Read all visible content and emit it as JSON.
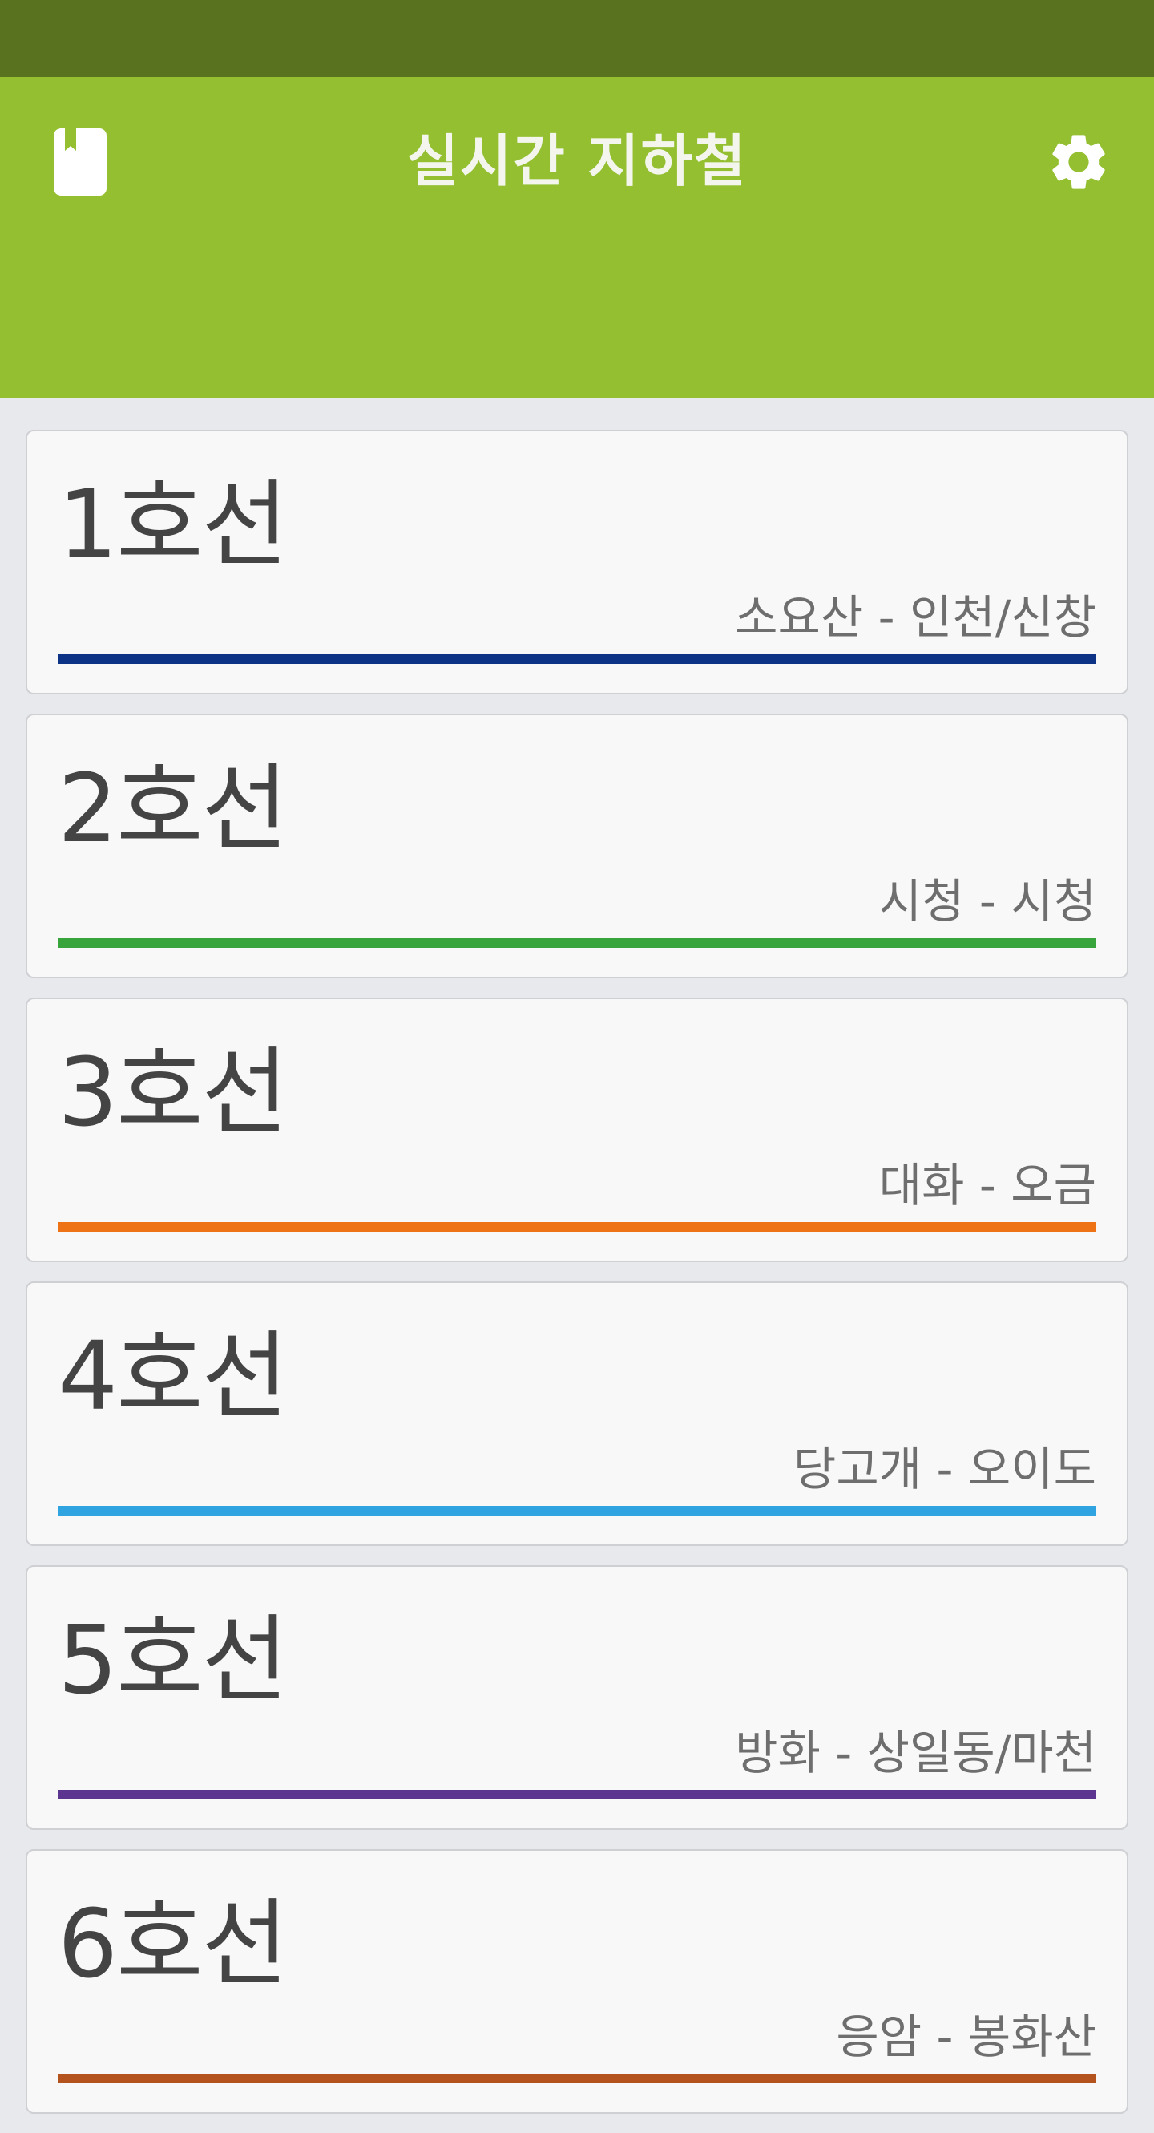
{
  "header": {
    "title": "실시간 지하철",
    "left_icon": "book-icon",
    "right_icon": "gear-icon",
    "color": "#93bf31",
    "status_bar_color": "#58721f"
  },
  "lines": [
    {
      "name": "1호선",
      "route": "소요산 - 인천/신창",
      "color": "#0d3386"
    },
    {
      "name": "2호선",
      "route": "시청 - 시청",
      "color": "#38a43c"
    },
    {
      "name": "3호선",
      "route": "대화 - 오금",
      "color": "#ee7316"
    },
    {
      "name": "4호선",
      "route": "당고개 - 오이도",
      "color": "#2fa4e0"
    },
    {
      "name": "5호선",
      "route": "방화 - 상일동/마천",
      "color": "#5b3590"
    },
    {
      "name": "6호선",
      "route": "응암 - 봉화산",
      "color": "#b5531f"
    }
  ]
}
